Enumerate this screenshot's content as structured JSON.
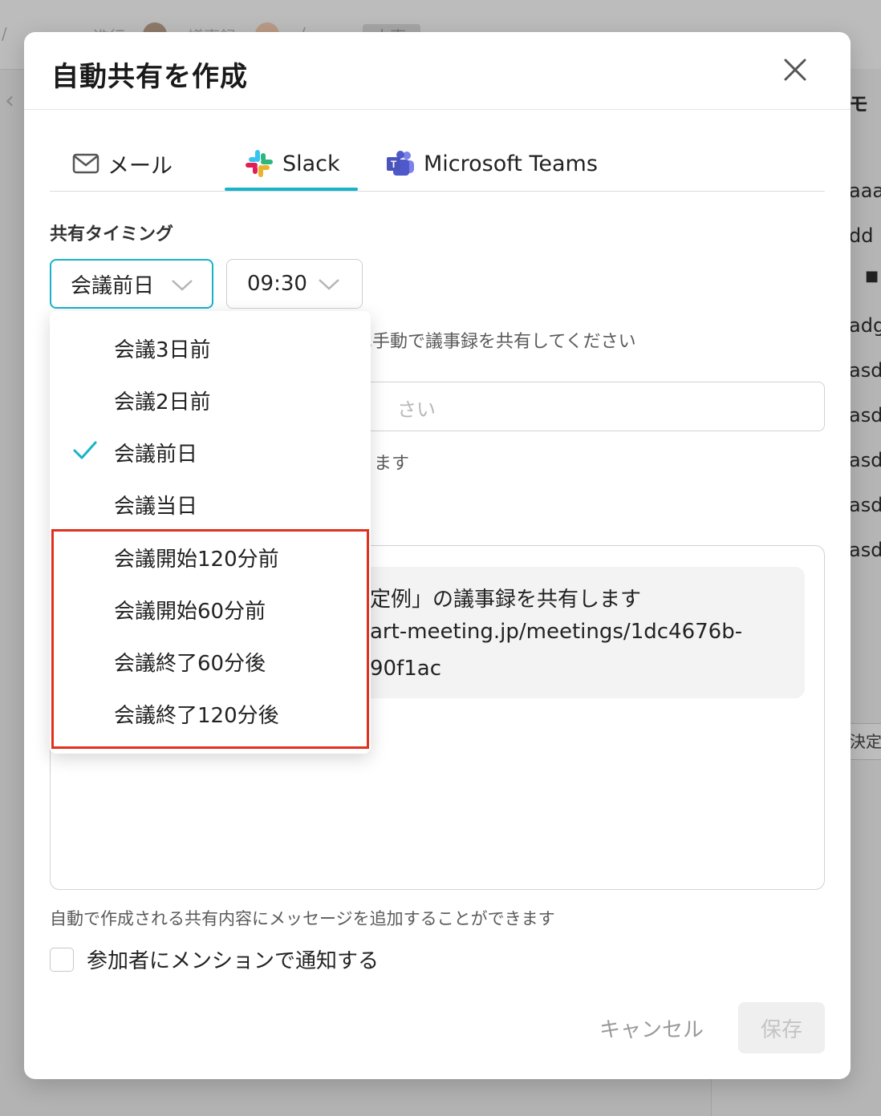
{
  "background": {
    "breadcrumb": [
      "/",
      "進行",
      "議事録",
      "/",
      "本事"
    ],
    "right_panel_title": "モ",
    "right_panel_lines": [
      "aaa",
      "dd",
      "■",
      "adg",
      "asd",
      "asd",
      "asd",
      "asd",
      "asd"
    ],
    "right_panel_button": "決定"
  },
  "modal": {
    "title": "自動共有を作成",
    "tabs": [
      {
        "label": "メール",
        "icon": "mail-icon",
        "active": false
      },
      {
        "label": "Slack",
        "icon": "slack-icon",
        "active": true
      },
      {
        "label": "Microsoft Teams",
        "icon": "teams-icon",
        "active": false
      }
    ],
    "timing_label": "共有タイミング",
    "day_select": {
      "value": "会議前日"
    },
    "time_select": {
      "value": "09:30"
    },
    "helper_manual": "は手動で議事録を共有してください",
    "input_placeholder": "さい",
    "helper_partial": "ます",
    "preview": {
      "line1": "定例」の議事録を共有します",
      "line2": "art-meeting.jp/meetings/1dc4676b-",
      "line3": "90f1ac"
    },
    "message_helper": "自動で作成される共有内容にメッセージを追加することができます",
    "mention_checkbox": {
      "label": "参加者にメンションで通知する",
      "checked": false
    },
    "cancel_label": "キャンセル",
    "save_label": "保存"
  },
  "dropdown": {
    "options": [
      {
        "label": "会議3日前",
        "selected": false
      },
      {
        "label": "会議2日前",
        "selected": false
      },
      {
        "label": "会議前日",
        "selected": true
      },
      {
        "label": "会議当日",
        "selected": false
      },
      {
        "label": "会議開始120分前",
        "selected": false
      },
      {
        "label": "会議開始60分前",
        "selected": false
      },
      {
        "label": "会議終了60分後",
        "selected": false
      },
      {
        "label": "会議終了120分後",
        "selected": false
      }
    ],
    "highlight_color": "#e0301e"
  },
  "colors": {
    "accent": "#17b3c9",
    "slack_red": "#e01e5a",
    "slack_green": "#2eb67d",
    "slack_yellow": "#ecb22e",
    "slack_blue": "#36c5f0",
    "teams": "#5059c9"
  }
}
